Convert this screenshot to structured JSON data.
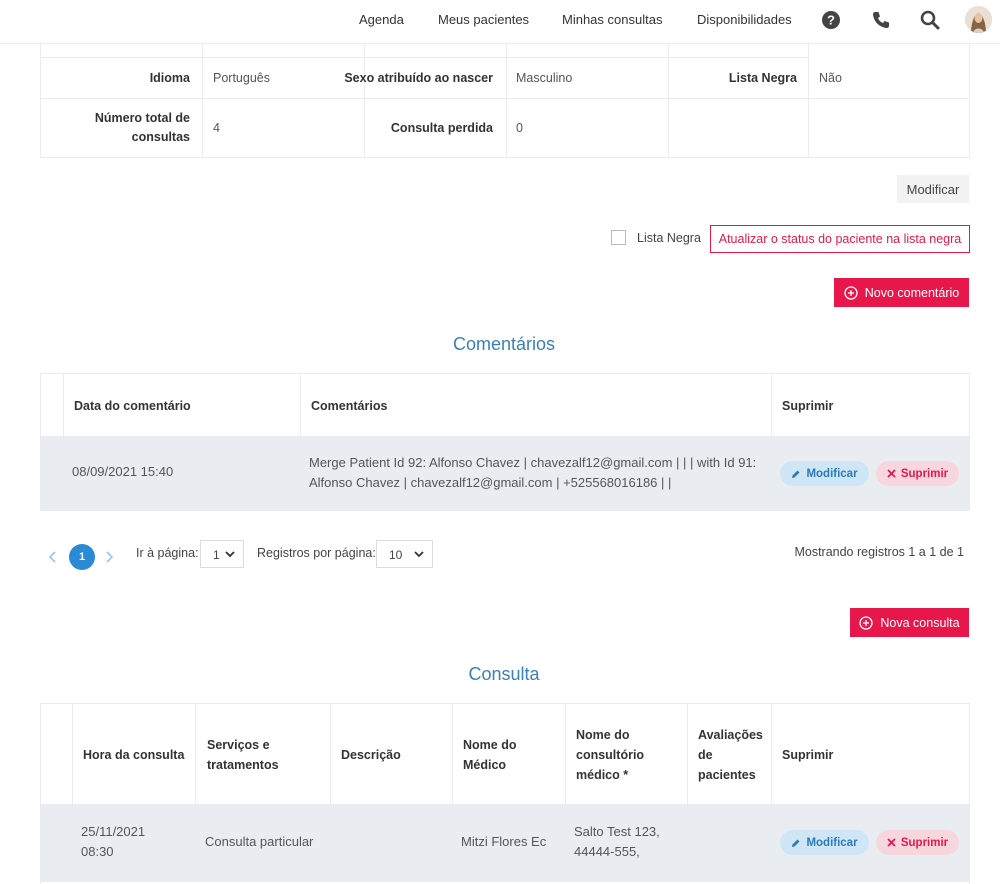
{
  "nav": {
    "links": [
      "Agenda",
      "Meus pacientes",
      "Minhas consultas",
      "Disponibilidades"
    ]
  },
  "info": {
    "row1": {
      "idioma_label": "Idioma",
      "idioma_value": "Português",
      "sexo_label": "Sexo atribuído ao nascer",
      "sexo_value": "Masculino",
      "lista_label": "Lista Negra",
      "lista_value": "Não"
    },
    "row2": {
      "total_label_1": "Número total de",
      "total_label_2": "consultas",
      "total_value": "4",
      "perdida_label": "Consulta perdida",
      "perdida_value": "0"
    }
  },
  "actions": {
    "modify": "Modificar",
    "blacklist_checkbox": "Lista Negra",
    "blacklist_update": "Atualizar o status do paciente na lista negra",
    "new_comment": "Novo comentário",
    "new_consult": "Nova consulta"
  },
  "comments": {
    "title": "Comentários",
    "headers": [
      "Data do comentário",
      "Comentários",
      "Suprimir"
    ],
    "rows": [
      {
        "date": "08/09/2021 15:40",
        "text_line1": "Merge Patient Id 92: Alfonso Chavez | chavezalf12@gmail.com | | | with Id 91:",
        "text_line2": "Alfonso Chavez | chavezalf12@gmail.com | +525568016186 | |",
        "modify": "Modificar",
        "delete": "Suprimir"
      }
    ]
  },
  "pagination": {
    "current_page": "1",
    "goto_label": "Ir à página:",
    "goto_value": "1",
    "per_page_label": "Registros por página:",
    "per_page_value": "10",
    "summary": "Mostrando registros 1 a 1 de 1"
  },
  "consult": {
    "title": "Consulta",
    "headers": {
      "hora": "Hora da consulta",
      "servicos_1": "Serviços e",
      "servicos_2": "tratamentos",
      "descricao": "Descrição",
      "medico_1": "Nome do",
      "medico_2": "Médico",
      "consultorio_1": "Nome do",
      "consultorio_2": "consultório",
      "consultorio_3": "médico *",
      "avaliacoes_1": "Avaliações",
      "avaliacoes_2": "de",
      "avaliacoes_3": "pacientes",
      "suprimir": "Suprimir"
    },
    "rows": [
      {
        "date_1": "25/11/2021",
        "date_2": "08:30",
        "service": "Consulta particular",
        "doctor": "Mitzi Flores Ec",
        "office_1": "Salto Test 123,",
        "office_2": "44444-555,",
        "modify": "Modificar",
        "delete": "Suprimir"
      }
    ]
  },
  "colors": {
    "accent": "#e8174b",
    "title_blue": "#3b7fb8",
    "pill_blue": "#cfe6f7",
    "pill_red": "#f7d7dd",
    "row_bg": "#e9edf2"
  },
  "icons": [
    "help-circle-icon",
    "phone-icon",
    "search-icon",
    "user-avatar",
    "plus-circle-icon",
    "pencil-icon",
    "x-icon",
    "chevron-left-icon",
    "chevron-right-icon",
    "chevron-down-icon"
  ]
}
